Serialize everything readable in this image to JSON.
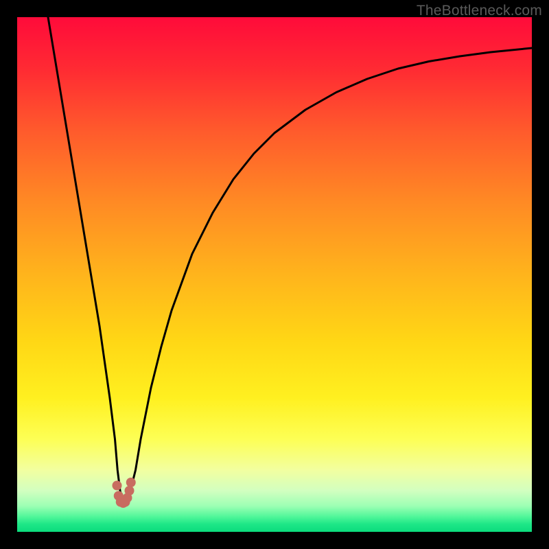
{
  "watermark": "TheBottleneck.com",
  "chart_data": {
    "type": "line",
    "title": "",
    "xlabel": "",
    "ylabel": "",
    "xlim": [
      0,
      100
    ],
    "ylim": [
      0,
      100
    ],
    "grid": false,
    "series": [
      {
        "name": "bottleneck-curve",
        "x": [
          6,
          8,
          10,
          12,
          14,
          16,
          17,
          18,
          19,
          19.5,
          20,
          20.5,
          21,
          22,
          23,
          24,
          26,
          28,
          30,
          34,
          38,
          42,
          46,
          50,
          56,
          62,
          68,
          74,
          80,
          86,
          92,
          100
        ],
        "y": [
          100,
          88,
          76,
          64,
          52,
          40,
          33,
          26,
          18,
          12,
          8,
          6,
          6,
          8,
          12,
          18,
          28,
          36,
          43,
          54,
          62,
          68.5,
          73.5,
          77.5,
          82,
          85.4,
          88,
          90,
          91.4,
          92.4,
          93.2,
          94
        ]
      },
      {
        "name": "valley-marker-dots",
        "x": [
          19.4,
          19.7,
          20.1,
          20.6,
          21.0,
          21.4,
          21.8,
          22.1
        ],
        "y": [
          9.0,
          7.0,
          5.8,
          5.6,
          5.8,
          6.6,
          8.0,
          9.6
        ]
      }
    ],
    "colors": {
      "curve": "#000000",
      "dots": "#c86c60"
    }
  }
}
